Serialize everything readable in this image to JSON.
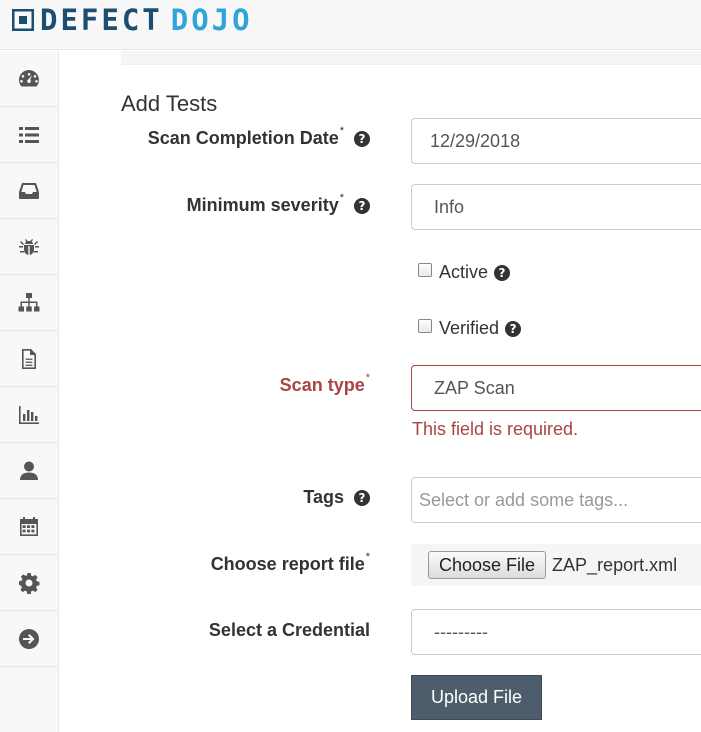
{
  "brand": {
    "part1": "DEFECT",
    "part2": "DOJO"
  },
  "sidebar": {
    "items": [
      {
        "icon": "dashboard-icon"
      },
      {
        "icon": "list-icon"
      },
      {
        "icon": "inbox-icon"
      },
      {
        "icon": "bug-icon"
      },
      {
        "icon": "sitemap-icon"
      },
      {
        "icon": "file-icon"
      },
      {
        "icon": "bar-chart-icon"
      },
      {
        "icon": "user-icon"
      },
      {
        "icon": "calendar-icon"
      },
      {
        "icon": "gear-icon"
      },
      {
        "icon": "arrow-right-circle-icon"
      }
    ]
  },
  "page": {
    "title": "Add Tests"
  },
  "form": {
    "scan_date": {
      "label": "Scan Completion Date",
      "required_mark": "*",
      "value": "12/29/2018"
    },
    "min_severity": {
      "label": "Minimum severity",
      "required_mark": "*",
      "value": "Info"
    },
    "active": {
      "label": "Active",
      "checked": false
    },
    "verified": {
      "label": "Verified",
      "checked": false
    },
    "scan_type": {
      "label": "Scan type",
      "required_mark": "*",
      "value": "ZAP Scan",
      "error": "This field is required."
    },
    "tags": {
      "label": "Tags",
      "placeholder": "Select or add some tags..."
    },
    "report_file": {
      "label": "Choose report file",
      "required_mark": "*",
      "button_label": "Choose File",
      "file_name": "ZAP_report.xml"
    },
    "credential": {
      "label": "Select a Credential",
      "value": "---------"
    },
    "submit_label": "Upload File"
  },
  "help_glyph": "?",
  "colors": {
    "error": "#a94442",
    "primary_button": "#4e5d6c",
    "brand_dark": "#1b4f72",
    "brand_light": "#2fa4d8"
  }
}
